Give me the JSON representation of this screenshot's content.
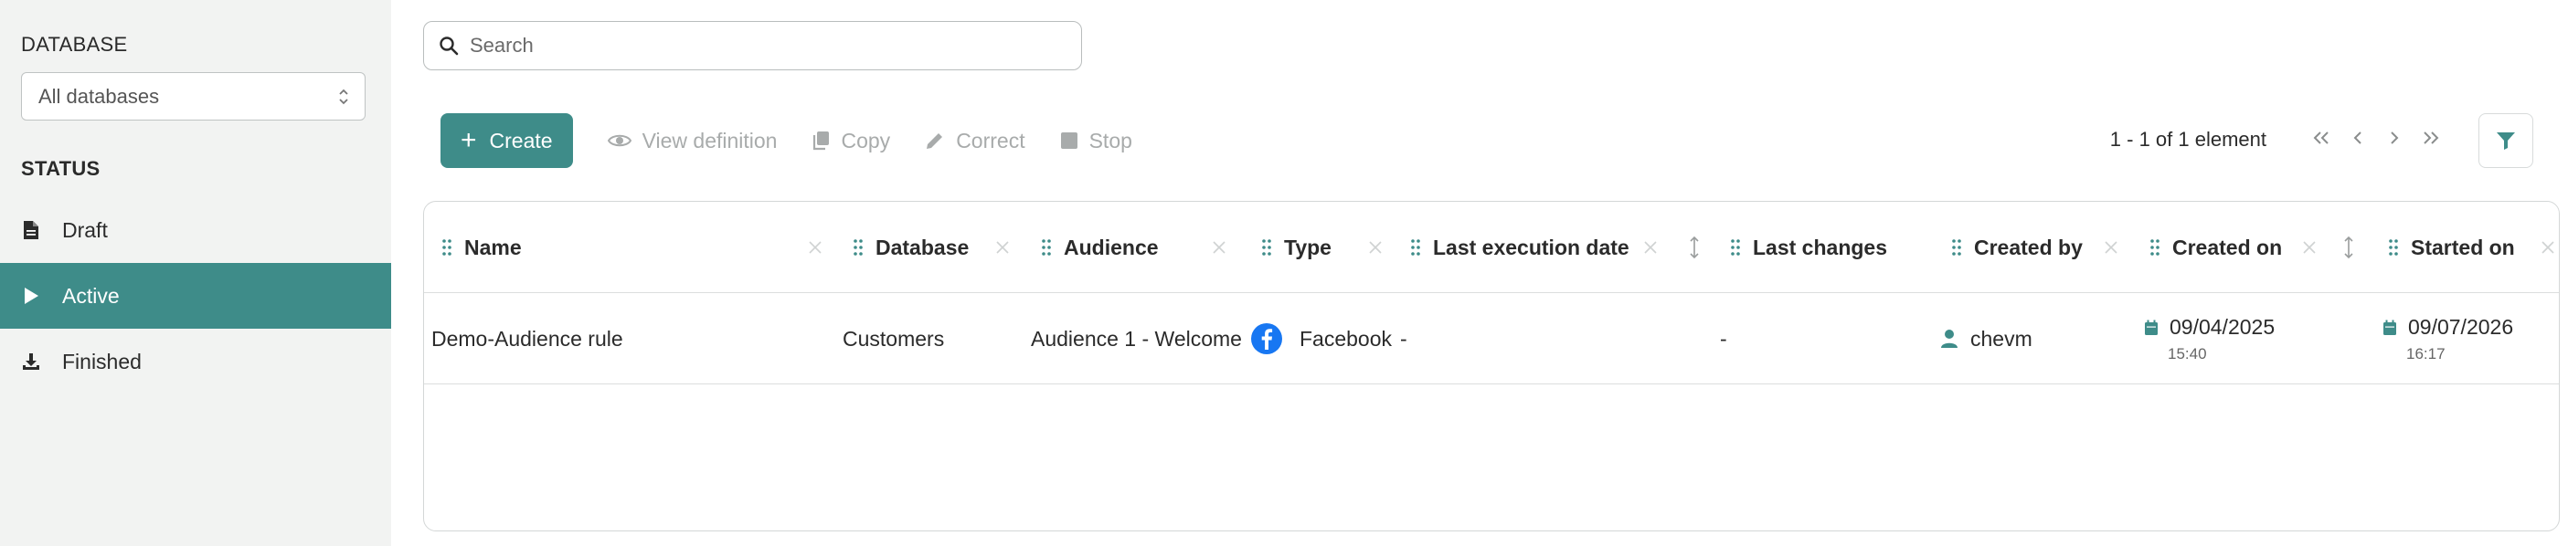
{
  "sidebar": {
    "database_title": "DATABASE",
    "database_select": "All databases",
    "status_title": "STATUS",
    "statuses": [
      {
        "label": "Draft",
        "icon": "file-icon"
      },
      {
        "label": "Active",
        "icon": "play-icon",
        "active": true
      },
      {
        "label": "Finished",
        "icon": "download-icon"
      }
    ]
  },
  "search": {
    "placeholder": "Search"
  },
  "toolbar": {
    "create": "Create",
    "view_definition": "View definition",
    "copy": "Copy",
    "correct": "Correct",
    "stop": "Stop"
  },
  "pager": {
    "text": "1 - 1 of 1 element"
  },
  "table": {
    "columns": [
      "Name",
      "Database",
      "Audience",
      "Type",
      "Last execution date",
      "Last changes",
      "Created by",
      "Created on",
      "Started on"
    ],
    "rows": [
      {
        "name": "Demo-Audience rule",
        "database": "Customers",
        "audience": "Audience 1 - Welcome",
        "type": "Facebook",
        "last_execution_date": "-",
        "last_changes": "-",
        "created_by": "chevm",
        "created_on_date": "09/04/2025",
        "created_on_time": "15:40",
        "started_on_date": "09/07/2026",
        "started_on_time": "16:17"
      }
    ]
  },
  "colors": {
    "accent": "#3e8c89",
    "facebook": "#1877f2",
    "disabled": "#a8abab"
  }
}
